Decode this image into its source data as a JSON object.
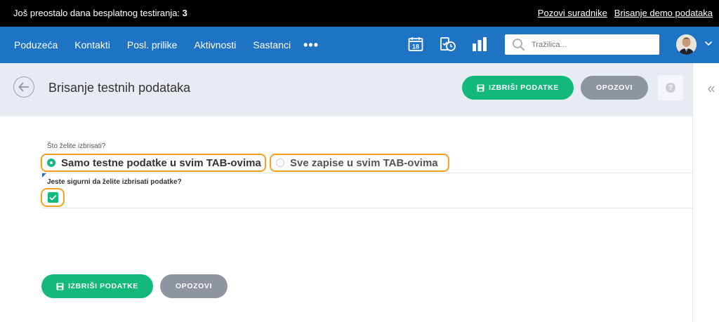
{
  "trial_bar": {
    "text_prefix": "Još preostalo dana besplatnog testiranja:",
    "days_left": "3",
    "invite_link": "Pozovi suradnike",
    "delete_demo_link": "Brisanje demo podataka"
  },
  "nav": {
    "items": [
      "Poduzeća",
      "Kontakti",
      "Posl. prilike",
      "Aktivnosti",
      "Sastanci"
    ],
    "more": "•••",
    "calendar_day": "18",
    "search_placeholder": "Tražilica..."
  },
  "header": {
    "title": "Brisanje testnih podataka",
    "delete_button": "IZBRIŠI PODATKE",
    "cancel_button": "OPOZOVI",
    "help": "?"
  },
  "form": {
    "question": "Što želite izbrisati?",
    "options": [
      {
        "label": "Samo testne podatke u svim TAB-ovima",
        "selected": true
      },
      {
        "label": "Sve zapise u svim TAB-ovima",
        "selected": false
      }
    ],
    "confirm_question": "Jeste sigurni da želite izbrisati podatke?",
    "confirm_checked": true,
    "delete_button": "IZBRIŠI PODATKE",
    "cancel_button": "OPOZOVI"
  },
  "colors": {
    "nav_bg": "#1e73c5",
    "primary_green": "#12b97a",
    "highlight_orange": "#f5a11c",
    "grey_button": "#8f959e"
  }
}
